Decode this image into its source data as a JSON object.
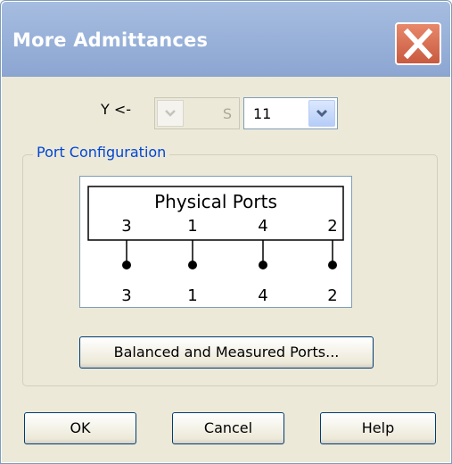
{
  "window": {
    "title": "More Admittances"
  },
  "y_selector": {
    "label": "Y <-",
    "unit": "S",
    "port_value": "11"
  },
  "port_config": {
    "legend": "Port Configuration",
    "header": "Physical Ports",
    "physical_ports": [
      "3",
      "1",
      "4",
      "2"
    ],
    "logical_ports": [
      "3",
      "1",
      "4",
      "2"
    ],
    "balanced_button": "Balanced and Measured Ports..."
  },
  "buttons": {
    "ok": "OK",
    "cancel": "Cancel",
    "help": "Help"
  },
  "icons": {
    "close": "close-icon",
    "dropdown": "chevron-down-icon"
  },
  "colors": {
    "title_bar": "#9cb5de",
    "legend": "#0046d5",
    "close": "#d86a4f"
  }
}
